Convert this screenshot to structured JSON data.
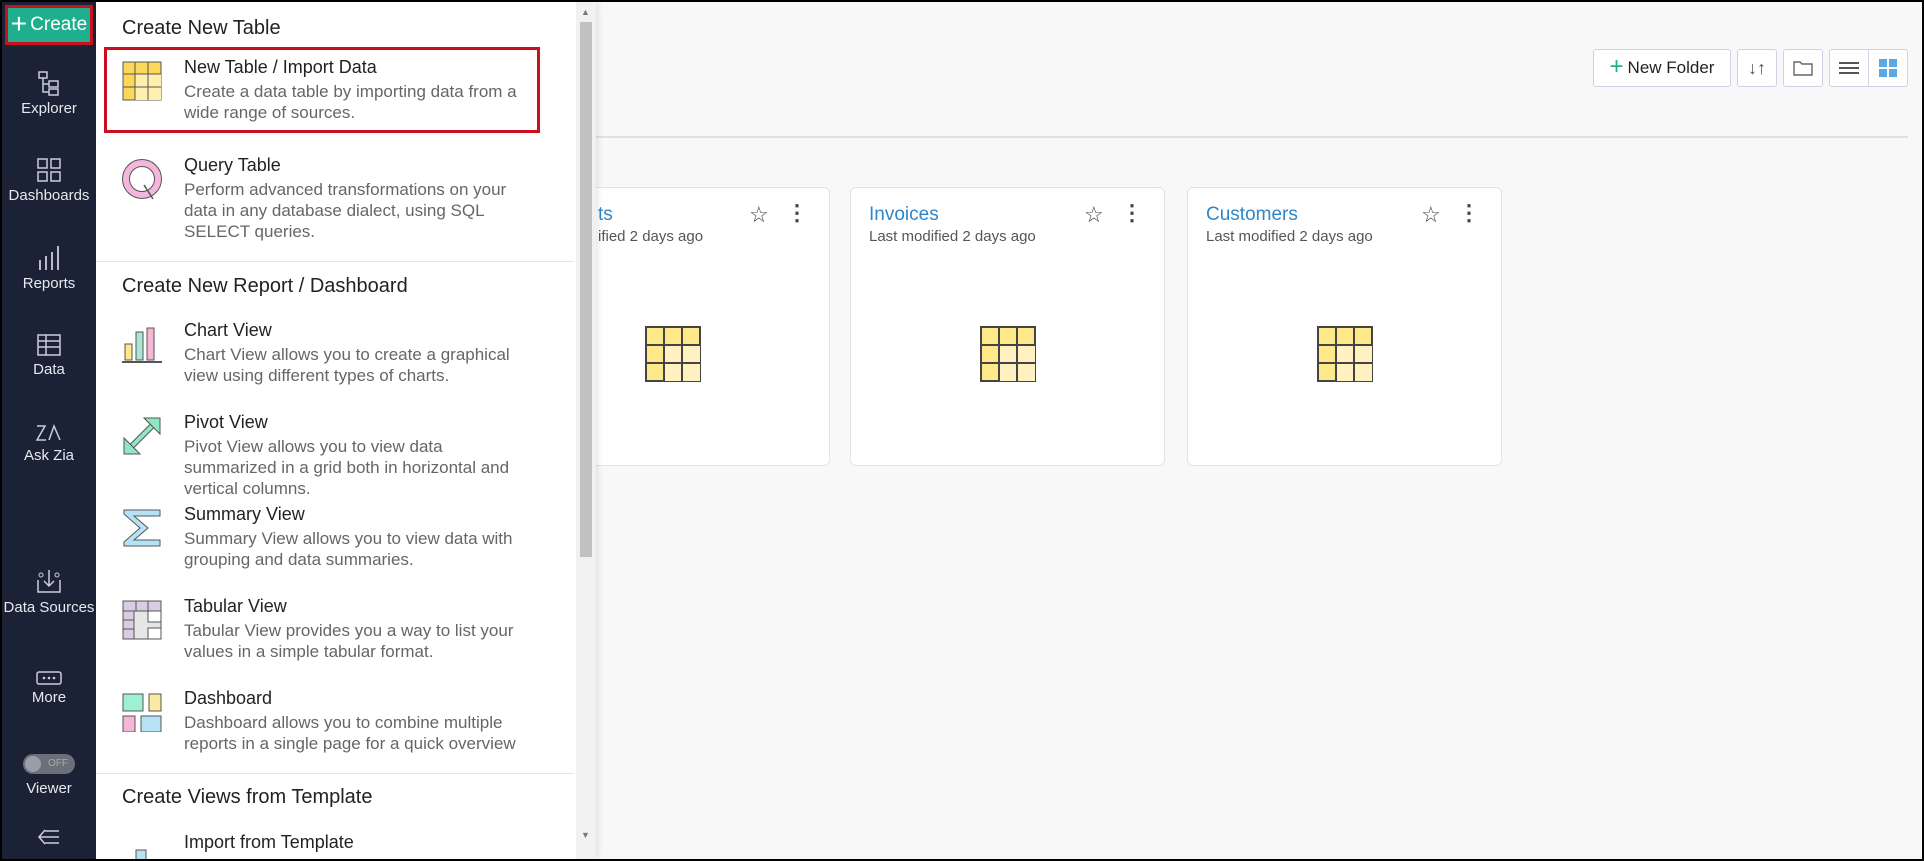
{
  "sidebar": {
    "create_label": "Create",
    "items": [
      {
        "label": "Explorer"
      },
      {
        "label": "Dashboards"
      },
      {
        "label": "Reports"
      },
      {
        "label": "Data"
      },
      {
        "label": "Ask Zia"
      },
      {
        "label": "Data Sources"
      },
      {
        "label": "More"
      }
    ],
    "viewer_toggle": {
      "state": "OFF",
      "label": "Viewer"
    }
  },
  "menu": {
    "sections": [
      {
        "heading": "Create New Table",
        "items": [
          {
            "title": "New Table / Import Data",
            "desc": "Create a data table by importing data from a wide range of sources."
          },
          {
            "title": "Query Table",
            "desc": "Perform advanced transformations on your data in any database dialect, using SQL SELECT queries."
          }
        ]
      },
      {
        "heading": "Create New Report / Dashboard",
        "items": [
          {
            "title": "Chart View",
            "desc": "Chart View allows you to create a graphical view using different types of charts."
          },
          {
            "title": "Pivot View",
            "desc": "Pivot View allows you to view data summarized in a grid both in horizontal and vertical columns."
          },
          {
            "title": "Summary View",
            "desc": "Summary View allows you to view data with grouping and data summaries."
          },
          {
            "title": "Tabular View",
            "desc": "Tabular View provides you a way to list your values in a simple tabular format."
          },
          {
            "title": "Dashboard",
            "desc": "Dashboard allows you to combine multiple reports in a single page for a quick overview"
          }
        ]
      },
      {
        "heading": "Create Views from Template",
        "items": [
          {
            "title": "Import from Template"
          }
        ]
      }
    ]
  },
  "toolbar": {
    "new_folder_label": "New Folder"
  },
  "cards": [
    {
      "title": "ts",
      "subtitle": "ified 2 days ago"
    },
    {
      "title": "Invoices",
      "subtitle": "Last modified 2 days ago"
    },
    {
      "title": "Customers",
      "subtitle": "Last modified 2 days ago"
    }
  ],
  "colors": {
    "sidebar": "#1c2236",
    "accent": "#1fae8e",
    "highlight": "#c8101e",
    "link": "#2f86c8"
  }
}
